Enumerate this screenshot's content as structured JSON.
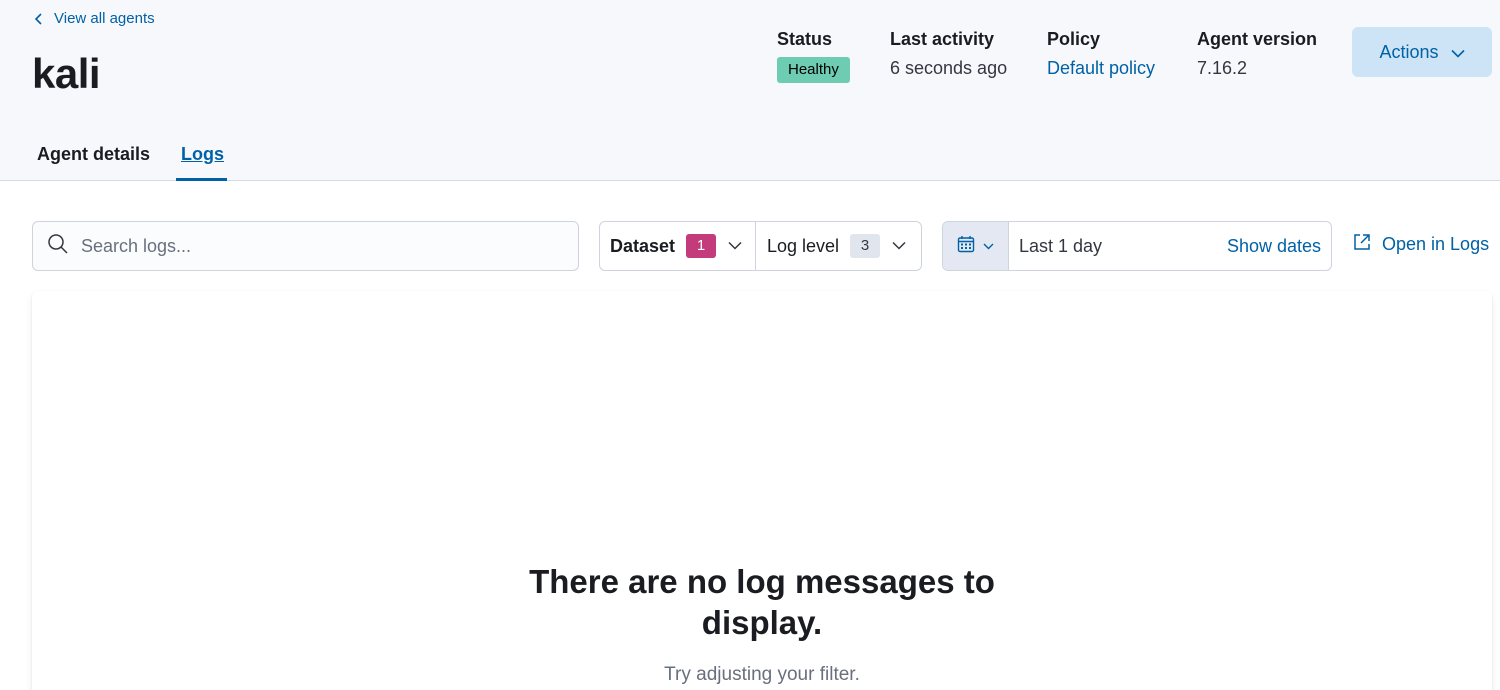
{
  "header": {
    "back_link": "View all agents",
    "agent_name": "kali",
    "status": {
      "label": "Status",
      "value": "Healthy",
      "color": "#6dccb1"
    },
    "last_activity": {
      "label": "Last activity",
      "value": "6 seconds ago"
    },
    "policy": {
      "label": "Policy",
      "value": "Default policy"
    },
    "agent_version": {
      "label": "Agent version",
      "value": "7.16.2"
    },
    "actions_label": "Actions"
  },
  "tabs": [
    {
      "label": "Agent details",
      "active": false
    },
    {
      "label": "Logs",
      "active": true
    }
  ],
  "toolbar": {
    "search_placeholder": "Search logs...",
    "dataset": {
      "label": "Dataset",
      "count": "1"
    },
    "log_level": {
      "label": "Log level",
      "count": "3"
    },
    "date_range": "Last 1 day",
    "show_dates": "Show dates",
    "open_in_logs": "Open in Logs"
  },
  "empty_state": {
    "title": "There are no log messages to display.",
    "subtitle": "Try adjusting your filter."
  },
  "colors": {
    "accent": "#0061a6",
    "dataset_badge": "#c33b7b"
  }
}
